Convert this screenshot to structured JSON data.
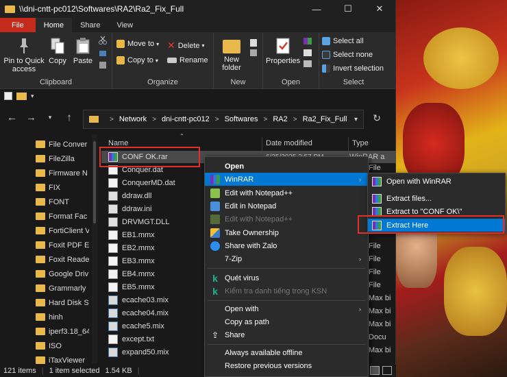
{
  "window": {
    "title": "\\\\dni-cntt-pc012\\Softwares\\RA2\\Ra2_Fix_Full",
    "controls": [
      "—",
      "☐",
      "✕"
    ]
  },
  "ribbon_tabs": [
    "File",
    "Home",
    "Share",
    "View"
  ],
  "ribbon": {
    "clipboard": {
      "label": "Clipboard",
      "pin": "Pin to Quick access",
      "copy": "Copy",
      "paste": "Paste"
    },
    "organize": {
      "label": "Organize",
      "move_to": "Move to",
      "copy_to": "Copy to",
      "delete": "Delete",
      "rename": "Rename"
    },
    "new": {
      "label": "New",
      "new_folder": "New folder"
    },
    "open": {
      "label": "Open",
      "properties": "Properties"
    },
    "select": {
      "label": "Select",
      "select_all": "Select all",
      "select_none": "Select none",
      "invert_selection": "Invert selection"
    }
  },
  "address": {
    "crumbs": [
      "Network",
      "dni-cntt-pc012",
      "Softwares",
      "RA2",
      "Ra2_Fix_Full"
    ],
    "separator": ">"
  },
  "nav_items": [
    "File Conver",
    "FileZilla",
    "Firmware N",
    "FIX",
    "FONT",
    "Format Fac",
    "FortiClient V",
    "Foxit PDF E",
    "Foxit Reade",
    "Google Driv",
    "Grammarly",
    "Hard Disk S",
    "hinh",
    "iperf3.18_64",
    "ISO",
    "iTaxViewer"
  ],
  "columns": {
    "name": "Name",
    "date": "Date modified",
    "type": "Type"
  },
  "files": [
    {
      "name": "CONF OK.rar",
      "icon": "rar",
      "date": "6/25/2025 3:57 PM",
      "type": "WinRAR a"
    },
    {
      "name": "Conquer.dat",
      "icon": "doc",
      "date": "",
      "type": "File"
    },
    {
      "name": "ConquerMD.dat",
      "icon": "doc",
      "date": "",
      "type": "File"
    },
    {
      "name": "ddraw.dll",
      "icon": "dll",
      "date": "",
      "type": ""
    },
    {
      "name": "ddraw.ini",
      "icon": "dll",
      "date": "",
      "type": ""
    },
    {
      "name": "DRVMGT.DLL",
      "icon": "dll",
      "date": "",
      "type": ""
    },
    {
      "name": "EB1.mmx",
      "icon": "doc",
      "date": "",
      "type": "File"
    },
    {
      "name": "EB2.mmx",
      "icon": "doc",
      "date": "",
      "type": "File"
    },
    {
      "name": "EB3.mmx",
      "icon": "doc",
      "date": "",
      "type": "File"
    },
    {
      "name": "EB4.mmx",
      "icon": "doc",
      "date": "",
      "type": "File"
    },
    {
      "name": "EB5.mmx",
      "icon": "doc",
      "date": "",
      "type": "File"
    },
    {
      "name": "ecache03.mix",
      "icon": "mix",
      "date": "",
      "type": "Max bi"
    },
    {
      "name": "ecache04.mix",
      "icon": "mix",
      "date": "",
      "type": "Max bi"
    },
    {
      "name": "ecache5.mix",
      "icon": "mix",
      "date": "",
      "type": "Max bi"
    },
    {
      "name": "except.txt",
      "icon": "doc",
      "date": "",
      "type": "Docu"
    },
    {
      "name": "expand50.mix",
      "icon": "mix",
      "date": "",
      "type": "Max bi"
    }
  ],
  "status": {
    "count": "121 items",
    "selected": "1 item selected",
    "size": "1.54 KB"
  },
  "context_menu": {
    "open": "Open",
    "winrar": "WinRAR",
    "edit_notepadpp": "Edit with Notepad++",
    "edit_notepad": "Edit in Notepad",
    "edit_notepadpp_disabled": "Edit with Notepad++",
    "take_ownership": "Take Ownership",
    "share_zalo": "Share with Zalo",
    "sevenzip": "7-Zip",
    "quet_virus": "Quét virus",
    "ksn": "Kiểm tra danh tiếng trong KSN",
    "open_with": "Open with",
    "copy_as_path": "Copy as path",
    "share": "Share",
    "always_offline": "Always available offline",
    "restore_versions": "Restore previous versions"
  },
  "winrar_submenu": {
    "open_with_winrar": "Open with WinRAR",
    "extract_files": "Extract files...",
    "extract_to": "Extract to \"CONF OK\\\"",
    "extract_here": "Extract Here"
  },
  "colors": {
    "accent": "#0078d4",
    "highlight_box": "#e0322a",
    "file_tab": "#c42b1c"
  }
}
